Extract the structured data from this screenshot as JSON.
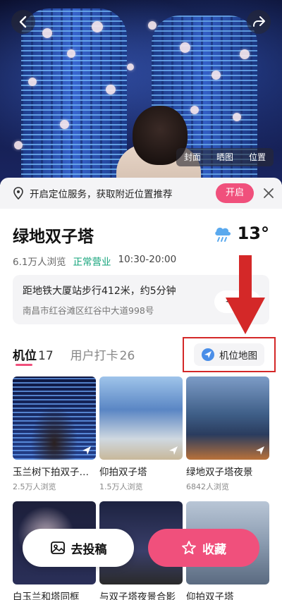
{
  "hero": {
    "tabs": [
      "封面",
      "晒图",
      "位置"
    ]
  },
  "location_banner": {
    "text": "开启定位服务，获取附近位置推荐",
    "open_label": "开启"
  },
  "place": {
    "title": "绿地双子塔",
    "temperature": "13°",
    "weather_icon": "rain-cloud-icon",
    "views": "6.1万人浏览",
    "status": "正常营业",
    "hours": "10:30-20:00"
  },
  "distance": {
    "main": "距地铁大厦站步行412米，约5分钟",
    "address": "南昌市红谷滩区红谷中大道998号"
  },
  "tabs": [
    {
      "label": "机位",
      "count": "17"
    },
    {
      "label": "用户打卡",
      "count": "26"
    }
  ],
  "map_button": {
    "label": "机位地图"
  },
  "spots": [
    {
      "title": "玉兰树下拍双子…",
      "views": "2.5万人浏览"
    },
    {
      "title": "仰拍双子塔",
      "views": "1.5万人浏览"
    },
    {
      "title": "绿地双子塔夜景",
      "views": "6842人浏览"
    },
    {
      "title": "白玉兰和塔同框"
    },
    {
      "title": "与双子塔夜景合影"
    },
    {
      "title": "仰拍双子塔"
    }
  ],
  "actions": {
    "submit_label": "去投稿",
    "favorite_label": "收藏"
  },
  "colors": {
    "accent": "#f0507c",
    "open_status": "#12a37a",
    "annotation_red": "#d42828"
  }
}
